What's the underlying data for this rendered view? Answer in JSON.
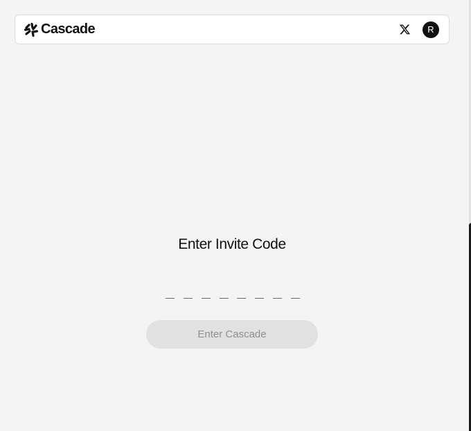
{
  "header": {
    "brand_name": "Cascade",
    "avatar_initial": "R"
  },
  "main": {
    "title": "Enter Invite Code",
    "code_length": 8,
    "submit_label": "Enter Cascade",
    "submit_disabled": true
  },
  "icons": {
    "logo": "cascade-logo-icon",
    "social": "x-icon"
  },
  "colors": {
    "background": "#f4f4f4",
    "header_background": "#ffffff",
    "avatar_background": "#111111",
    "button_disabled_background": "#e1e1e1",
    "button_disabled_text": "#8f8f8f"
  }
}
